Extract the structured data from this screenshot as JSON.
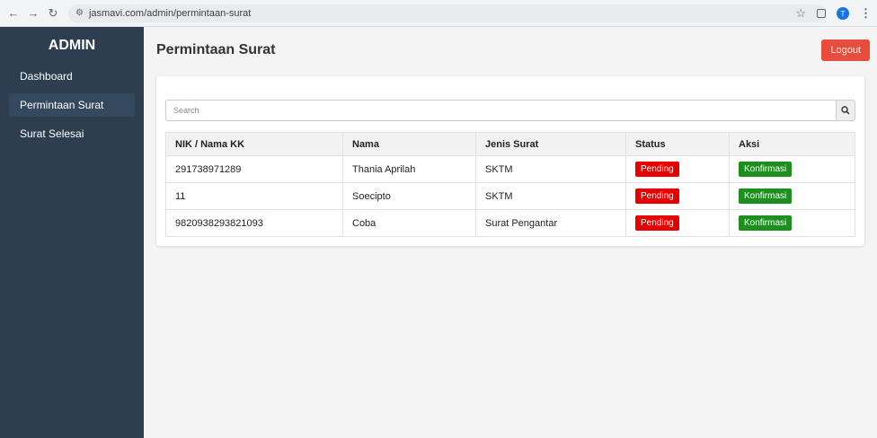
{
  "browser": {
    "url": "jasmavi.com/admin/permintaan-surat",
    "profile_initial": "T"
  },
  "sidebar": {
    "brand": "ADMIN",
    "items": [
      {
        "label": "Dashboard"
      },
      {
        "label": "Permintaan Surat"
      },
      {
        "label": "Surat Selesai"
      }
    ]
  },
  "header": {
    "title": "Permintaan Surat",
    "logout_label": "Logout"
  },
  "search": {
    "placeholder": "Search"
  },
  "table": {
    "columns": [
      "NIK / Nama KK",
      "Nama",
      "Jenis Surat",
      "Status",
      "Aksi"
    ],
    "rows": [
      {
        "nik": "291738971289",
        "nama": "Thania Aprilah",
        "jenis": "SKTM",
        "status": "Pending",
        "aksi": "Konfirmasi"
      },
      {
        "nik": "11",
        "nama": "Soecipto",
        "jenis": "SKTM",
        "status": "Pending",
        "aksi": "Konfirmasi"
      },
      {
        "nik": "9820938293821093",
        "nama": "Coba",
        "jenis": "Surat Pengantar",
        "status": "Pending",
        "aksi": "Konfirmasi"
      }
    ]
  }
}
